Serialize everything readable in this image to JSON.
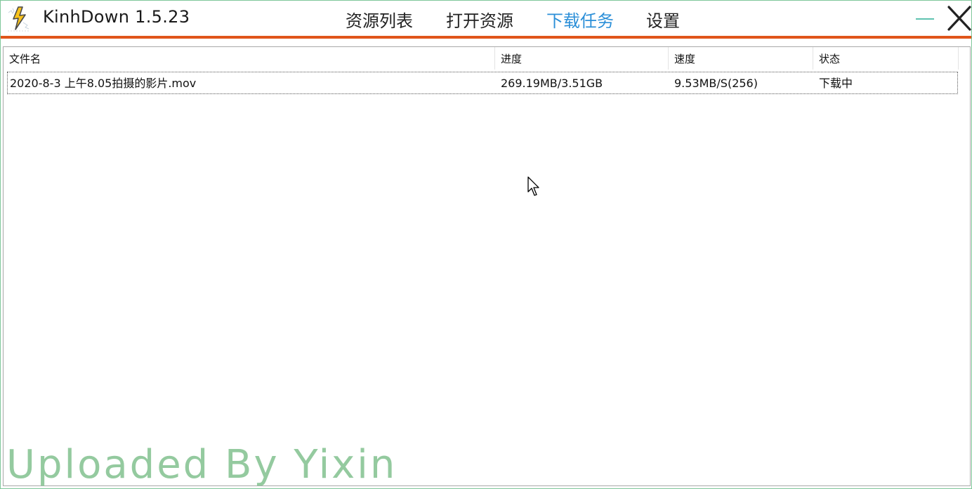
{
  "app": {
    "title": "KinhDown 1.5.23",
    "icon": "lightning-bolt-icon",
    "accent_color": "#e0551a",
    "active_tab_color": "#2b8fd8"
  },
  "nav": {
    "tabs": [
      {
        "label": "资源列表",
        "active": false
      },
      {
        "label": "打开资源",
        "active": false
      },
      {
        "label": "下载任务",
        "active": true
      },
      {
        "label": "设置",
        "active": false
      }
    ]
  },
  "window_controls": {
    "minimize_icon": "minimize-icon",
    "close_icon": "close-icon"
  },
  "table": {
    "columns": [
      "文件名",
      "进度",
      "速度",
      "状态"
    ],
    "rows": [
      {
        "filename": "2020-8-3 上午8.05拍摄的影片.mov",
        "progress": "269.19MB/3.51GB",
        "speed": "9.53MB/S(256)",
        "status": "下载中"
      }
    ]
  },
  "watermark": "Uploaded By Yixin"
}
